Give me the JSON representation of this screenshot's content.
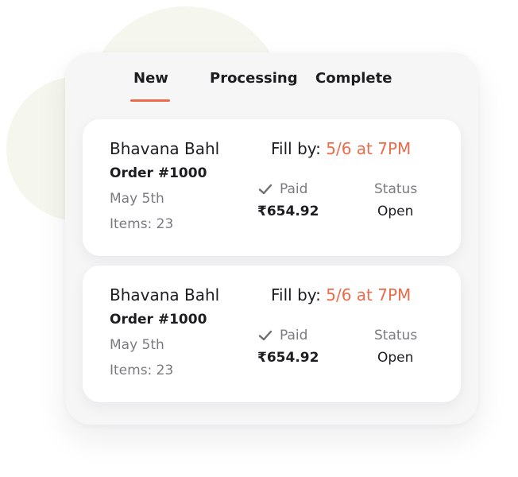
{
  "tabs": [
    {
      "label": "New",
      "active": true
    },
    {
      "label": "Processing",
      "active": false
    },
    {
      "label": "Complete",
      "active": false
    }
  ],
  "accent_color": "#ec6b4a",
  "orders": [
    {
      "customer_name": "Bhavana Bahl",
      "order_number": "Order #1000",
      "date": "May 5th",
      "items": "Items:  23",
      "fill_by_label": "Fill by:",
      "fill_by_value": "5/6 at 7PM",
      "payment_icon": "check-icon",
      "payment_status": "Paid",
      "amount": "₹654.92",
      "status_label": "Status",
      "status_value": "Open"
    },
    {
      "customer_name": "Bhavana Bahl",
      "order_number": "Order #1000",
      "date": "May 5th",
      "items": "Items:  23",
      "fill_by_label": "Fill by:",
      "fill_by_value": "5/6 at 7PM",
      "payment_icon": "check-icon",
      "payment_status": "Paid",
      "amount": "₹654.92",
      "status_label": "Status",
      "status_value": "Open"
    }
  ]
}
